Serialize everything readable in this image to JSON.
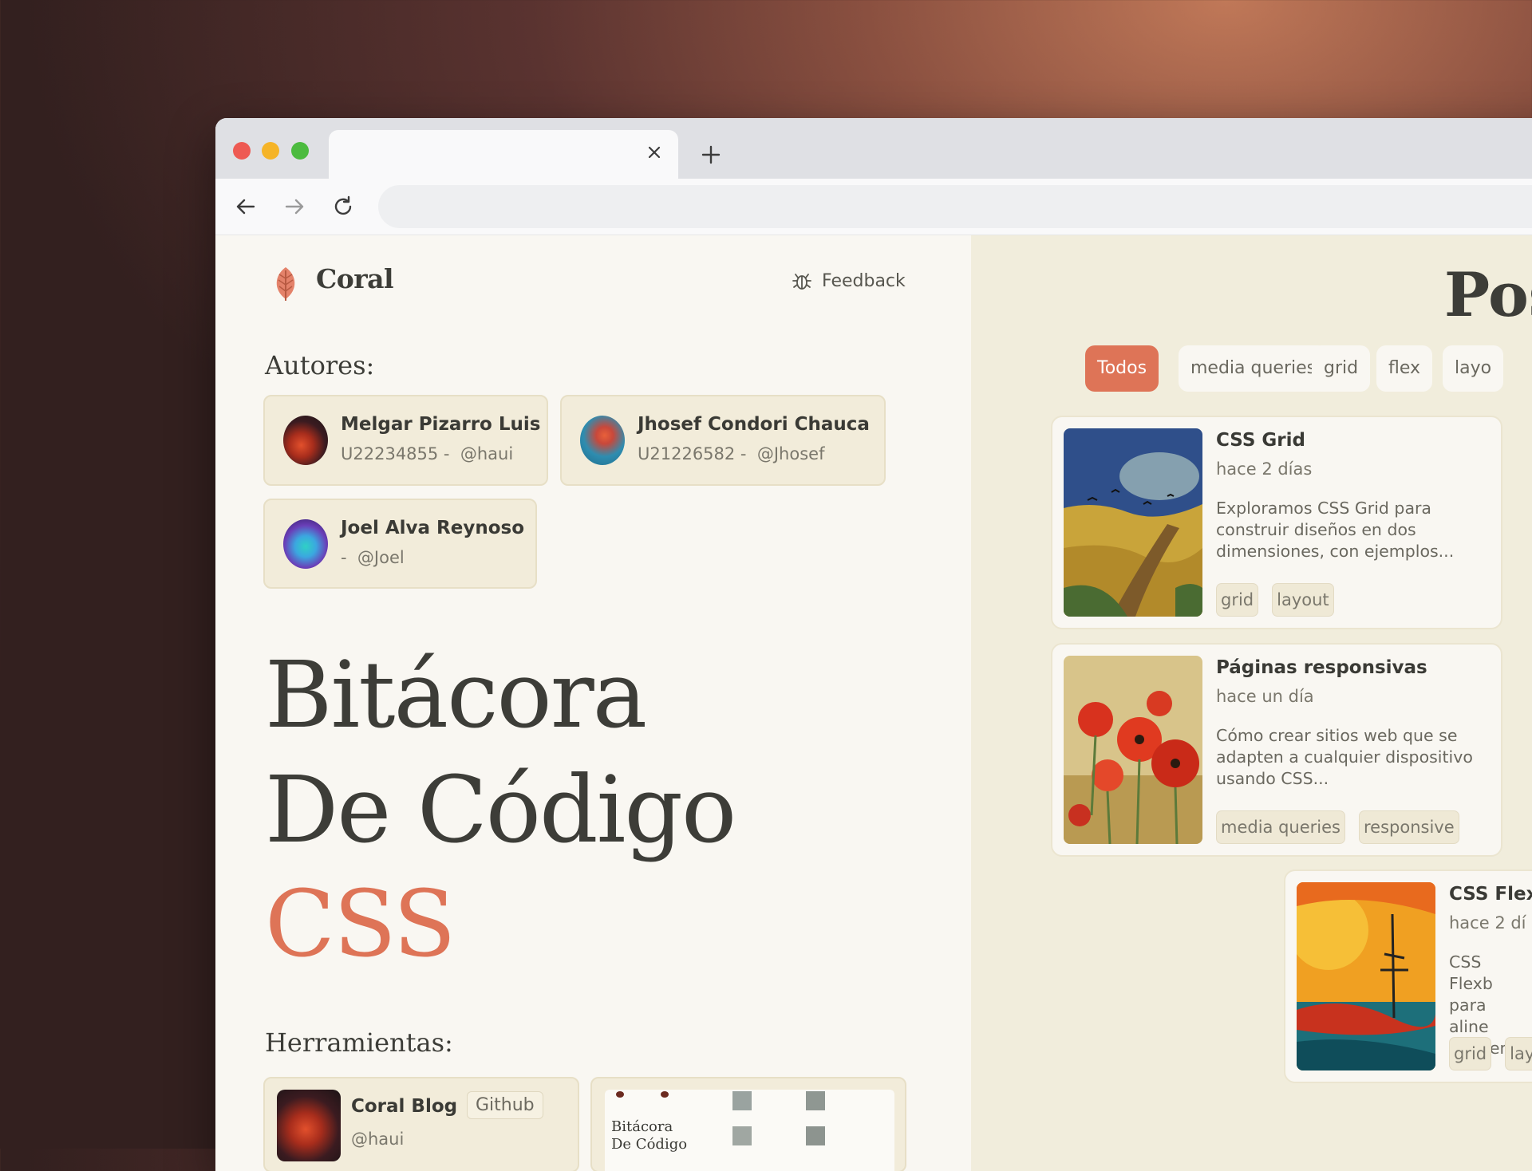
{
  "browser": {
    "tab_title": "",
    "url": ""
  },
  "header": {
    "brand": "Coral",
    "feedback_label": "Feedback"
  },
  "authors": {
    "title": "Autores:",
    "items": [
      {
        "name": "Melgar Pizarro Luis",
        "meta": "U22234855 -  @haui"
      },
      {
        "name": "Jhosef Condori Chauca",
        "meta": "U21226582 -  @Jhosef"
      },
      {
        "name": "Joel Alva Reynoso",
        "meta": "-  @Joel"
      }
    ]
  },
  "hero": {
    "line1": "Bitácora",
    "line2": "De Código",
    "line3": "CSS"
  },
  "tools": {
    "title": "Herramientas:",
    "items": [
      {
        "name": "Coral Blog",
        "button": "Github",
        "handle": "@haui"
      },
      {
        "preview_text_1": "Bitácora",
        "preview_text_2": "De Código"
      }
    ]
  },
  "posts": {
    "title": "Pos",
    "filters": [
      "Todos",
      "media queries",
      "grid",
      "flex",
      "layo"
    ],
    "active_filter": "Todos",
    "items": [
      {
        "title": "CSS Grid",
        "date": "hace 2 días",
        "description": "Exploramos CSS Grid para construir diseños en dos dimensiones, con ejemplos...",
        "tags": [
          "grid",
          "layout"
        ]
      },
      {
        "title": "Páginas responsivas",
        "date": "hace un día",
        "description": "Cómo crear sitios web que se adapten a cualquier dispositivo usando CSS...",
        "tags": [
          "media queries",
          "responsive"
        ]
      },
      {
        "title": "CSS Flex",
        "date": "hace 2 dí",
        "description": "CSS Flexb para aline elemento",
        "tags": [
          "grid",
          "lay"
        ]
      }
    ]
  },
  "colors": {
    "accent": "#de7457",
    "left_bg": "#f9f7f2",
    "right_bg": "#f1eddc",
    "card_bg": "#f2ecda",
    "text": "#3d3d38"
  }
}
